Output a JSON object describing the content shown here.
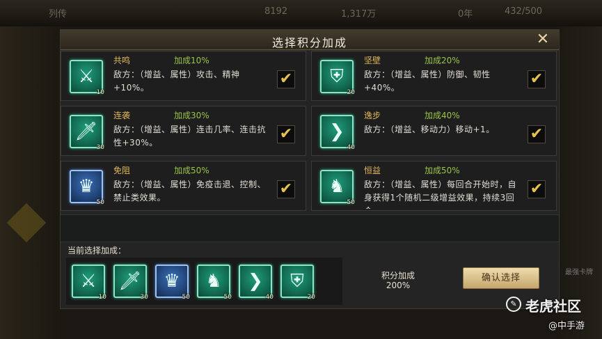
{
  "background": {
    "top_texts": [
      "列传",
      "8192",
      "1,317万",
      "0年",
      "432/500"
    ],
    "right_label": "最强卡牌"
  },
  "dialog": {
    "title": "选择积分加成",
    "close_label": "✕"
  },
  "options": [
    {
      "name": "共鸣",
      "bonus": "加成10%",
      "desc": "敌方：（增益、属性）攻击、精神+10%。",
      "icon": "crossed-swords-icon",
      "glyph": "⚔",
      "level": "10",
      "checked": true,
      "style": "green"
    },
    {
      "name": "坚壁",
      "bonus": "加成20%",
      "desc": "敌方：（增益、属性）防御、韧性+40%。",
      "icon": "shield-icon",
      "glyph": "⛨",
      "level": "20",
      "checked": true,
      "style": "green"
    },
    {
      "name": "连袭",
      "bonus": "加成30%",
      "desc": "敌方：（增益、属性）连击几率、连击抗性+30%。",
      "icon": "sword-icon",
      "glyph": "🗡",
      "level": "30",
      "checked": true,
      "style": "green"
    },
    {
      "name": "逸步",
      "bonus": "加成40%",
      "desc": "敌方：（增益、移动力）移动+1。",
      "icon": "arrow-right-icon",
      "glyph": "❯",
      "level": "40",
      "checked": true,
      "style": "green"
    },
    {
      "name": "免阻",
      "bonus": "加成50%",
      "desc": "敌方：（增益、属性）免疫击退、控制、禁止类效果。",
      "icon": "armored-figure-icon",
      "glyph": "♛",
      "level": "50",
      "checked": true,
      "style": "blue"
    },
    {
      "name": "恒益",
      "bonus": "加成50%",
      "desc": "敌方：（增益、属性）每回合开始时，自身获得1个随机二级增益效果，持续3回合",
      "icon": "warriors-icon",
      "glyph": "♞",
      "level": "50",
      "checked": true,
      "style": "green"
    }
  ],
  "current": {
    "label": "当前选择加成：",
    "icons": [
      {
        "icon": "crossed-swords-icon",
        "glyph": "⚔",
        "level": "10",
        "style": "green"
      },
      {
        "icon": "sword-icon",
        "glyph": "🗡",
        "level": "30",
        "style": "green"
      },
      {
        "icon": "armored-figure-icon",
        "glyph": "♛",
        "level": "50",
        "style": "blue"
      },
      {
        "icon": "warriors-icon",
        "glyph": "♞",
        "level": "50",
        "style": "green"
      },
      {
        "icon": "arrow-right-icon",
        "glyph": "❯",
        "level": "40",
        "style": "green"
      },
      {
        "icon": "shield-icon",
        "glyph": "⛨",
        "level": "20",
        "style": "green"
      }
    ]
  },
  "score": {
    "label": "积分加成",
    "value": "200%"
  },
  "confirm_label": "确认选择",
  "watermark": {
    "brand": "老虎社区",
    "sub": "@中手游"
  },
  "colors": {
    "accent_green": "#1e9c7a",
    "check_yellow": "#e6c44a",
    "name_gold": "#e0b85b",
    "bonus_green": "#9ac546"
  }
}
